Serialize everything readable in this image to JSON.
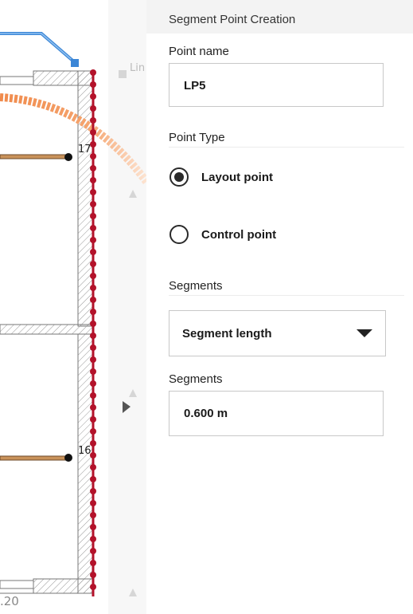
{
  "canvas": {
    "point_labels": [
      "17",
      "16"
    ],
    "ruler_label": ".20",
    "ghost_label": "Lin"
  },
  "panel": {
    "title": "Segment Point Creation",
    "point_name_label": "Point name",
    "point_name_value": "LP5",
    "point_type_title": "Point Type",
    "options": [
      {
        "label": "Layout point",
        "selected": true
      },
      {
        "label": "Control point",
        "selected": false
      }
    ],
    "segments_title": "Segments",
    "segments_select_value": "Segment length",
    "segments_field_label": "Segments",
    "segments_field_value": "0.600 m"
  }
}
